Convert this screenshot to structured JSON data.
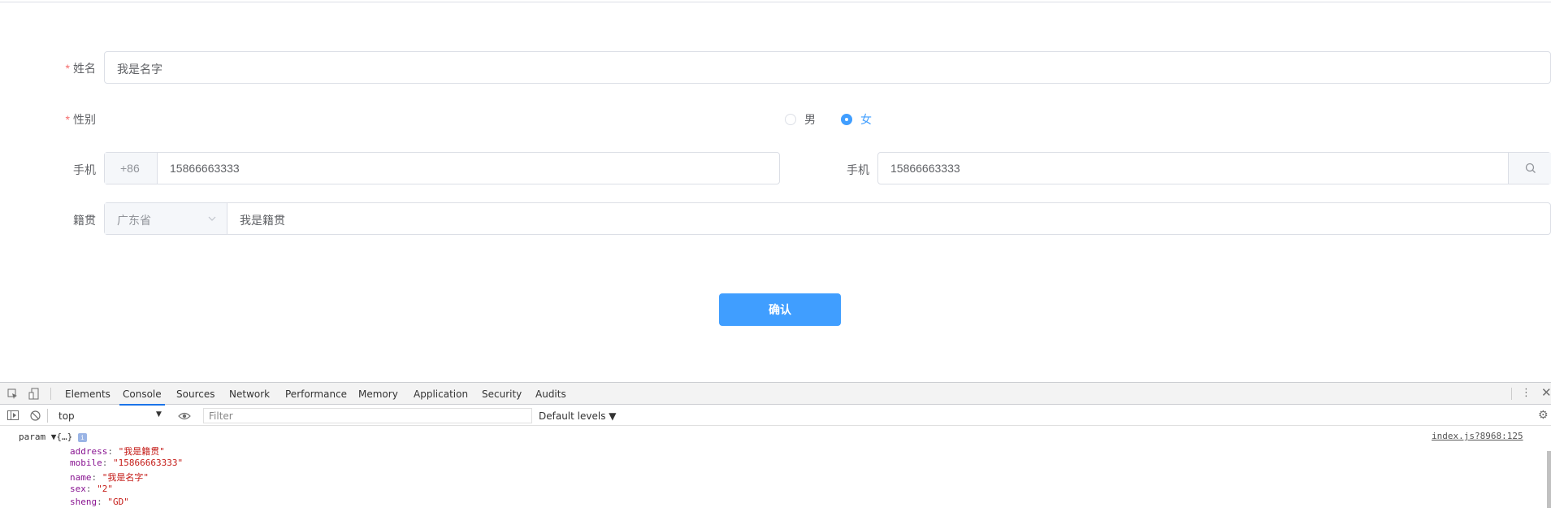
{
  "form": {
    "name": {
      "label": "姓名",
      "required": "*",
      "value": "我是名字"
    },
    "sex": {
      "label": "性别",
      "required": "*",
      "options": [
        "男",
        "女"
      ],
      "selected": "女"
    },
    "mobile": {
      "label": "手机",
      "prefix": "+86",
      "value": "15866663333"
    },
    "mobile2": {
      "label": "手机",
      "value": "15866663333"
    },
    "origin": {
      "label": "籍贯",
      "province": "广东省",
      "value": "我是籍贯"
    },
    "submit_label": "确认"
  },
  "devtools": {
    "tabs": [
      "Elements",
      "Console",
      "Sources",
      "Network",
      "Performance",
      "Memory",
      "Application",
      "Security",
      "Audits"
    ],
    "active_tab": "Console",
    "context": "top",
    "filter_placeholder": "Filter",
    "levels": "Default levels ▼",
    "log": {
      "label": "param",
      "summary": "▼{…}",
      "source": "index.js?8968:125",
      "entries": [
        {
          "key": "address",
          "value": "\"我是籍贯\""
        },
        {
          "key": "mobile",
          "value": "\"15866663333\""
        },
        {
          "key": "name",
          "value": "\"我是名字\""
        },
        {
          "key": "sex",
          "value": "\"2\""
        },
        {
          "key": "sheng",
          "value": "\"GD\""
        }
      ]
    }
  },
  "colors": {
    "primary": "#409eff",
    "required": "#f56c6c",
    "border": "#dcdfe6"
  }
}
